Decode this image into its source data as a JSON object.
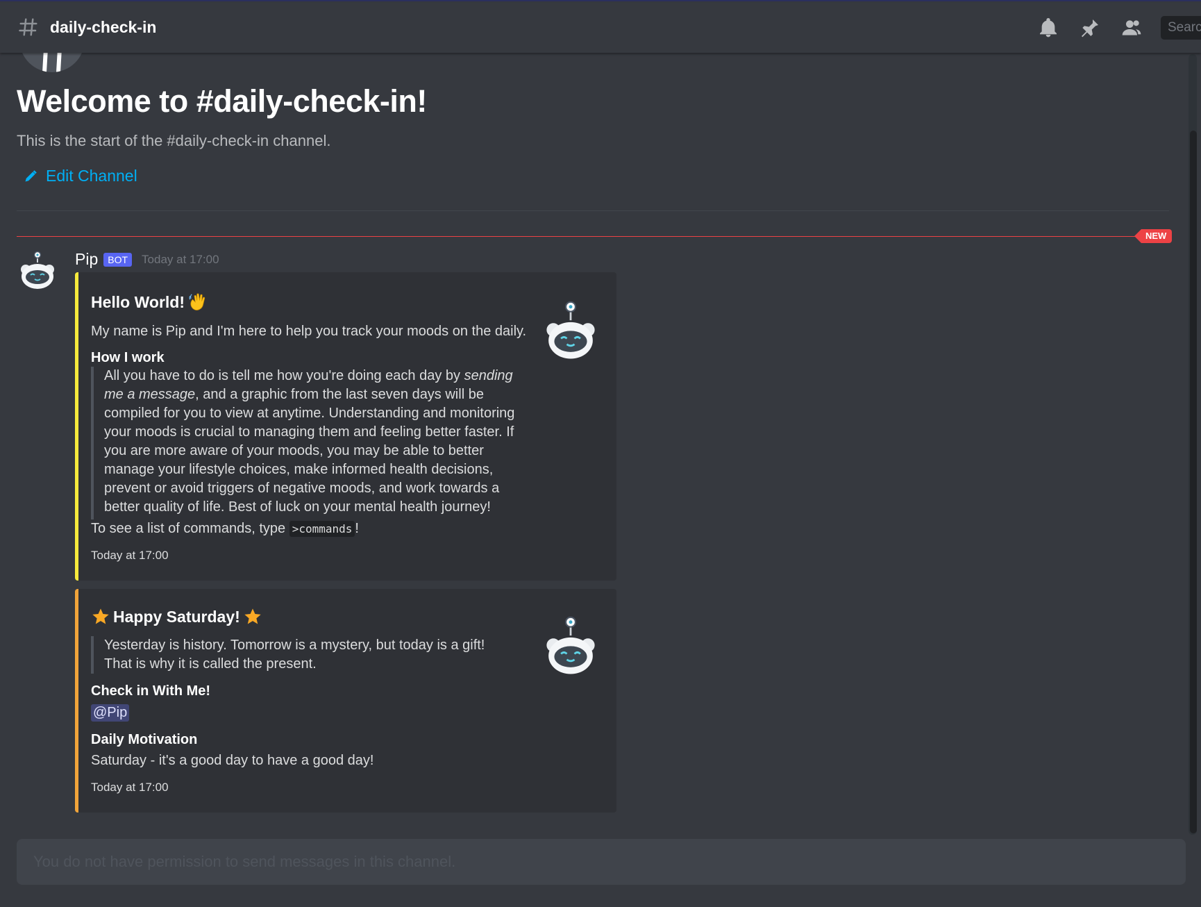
{
  "header": {
    "channel": "daily-check-in",
    "search_placeholder": "Searc"
  },
  "welcome": {
    "title": "Welcome to #daily-check-in!",
    "subtitle": "This is the start of the #daily-check-in channel.",
    "edit_label": "Edit Channel"
  },
  "new_badge": "NEW",
  "message": {
    "author": "Pip",
    "bot_tag": "BOT",
    "timestamp": "Today at 17:00",
    "embeds": [
      {
        "title": "Hello World!",
        "description": "My name is Pip and I'm here to help you track your moods on the daily.",
        "field_name": "How I work",
        "quote_lines": [
          "All you have to do is tell me how you're doing each day by",
          "sending",
          "me a message",
          ", and a graphic from the last seven days will be",
          "compiled for you to view at anytime. Understanding and monitoring",
          "your moods is crucial to managing them and feeling better faster. If",
          "you are more aware of your moods, you may be able to better",
          "manage your lifestyle choices, make informed health decisions,",
          "prevent or avoid triggers of negative moods, and work towards a",
          "better quality of life. Best of luck on your mental health journey!"
        ],
        "commands_prefix": "To see a list of commands, type",
        "commands_code": ">commands",
        "commands_suffix": "!",
        "footer": "Today at 17:00",
        "accent": "#f7ea3c"
      },
      {
        "title": "Happy Saturday!",
        "quote_lines": [
          "Yesterday is history. Tomorrow is a mystery, but today is a gift!",
          "That is why it is called the present."
        ],
        "field1_name": "Check in With Me!",
        "field1_value": "@Pip",
        "field2_name": "Daily Motivation",
        "field2_value": "Saturday - it's a good day to have a good day!",
        "footer": "Today at 17:00",
        "accent": "#f1a43a"
      }
    ]
  },
  "input": {
    "placeholder": "You do not have permission to send messages in this channel."
  }
}
